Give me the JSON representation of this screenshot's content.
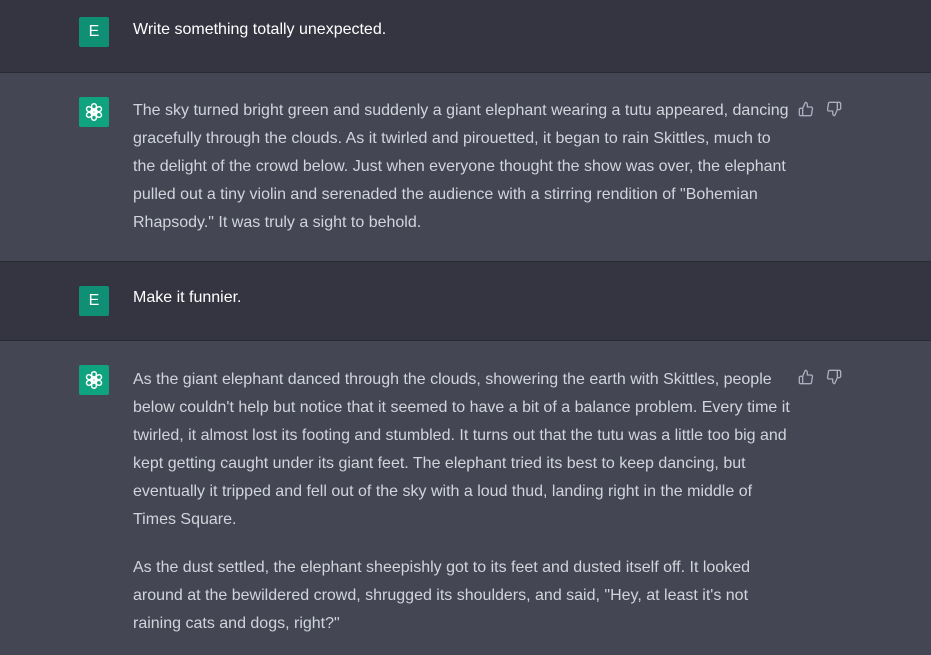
{
  "colors": {
    "user_bg": "#343541",
    "assistant_bg": "#444654",
    "user_avatar": "#0f8f74",
    "bot_avatar": "#10a37f",
    "assistant_text": "#d1d5db",
    "icon": "#acacbe"
  },
  "messages": [
    {
      "role": "user",
      "avatar_initial": "E",
      "text": "Write something totally unexpected."
    },
    {
      "role": "assistant",
      "avatar_icon": "openai-logo-icon",
      "paragraphs": [
        "The sky turned bright green and suddenly a giant elephant wearing a tutu appeared, dancing gracefully through the clouds. As it twirled and pirouetted, it began to rain Skittles, much to the delight of the crowd below. Just when everyone thought the show was over, the elephant pulled out a tiny violin and serenaded the audience with a stirring rendition of \"Bohemian Rhapsody.\" It was truly a sight to behold."
      ],
      "feedback_icons": [
        "thumbs-up-icon",
        "thumbs-down-icon"
      ]
    },
    {
      "role": "user",
      "avatar_initial": "E",
      "text": "Make it funnier."
    },
    {
      "role": "assistant",
      "avatar_icon": "openai-logo-icon",
      "paragraphs": [
        "As the giant elephant danced through the clouds, showering the earth with Skittles, people below couldn't help but notice that it seemed to have a bit of a balance problem. Every time it twirled, it almost lost its footing and stumbled. It turns out that the tutu was a little too big and kept getting caught under its giant feet. The elephant tried its best to keep dancing, but eventually it tripped and fell out of the sky with a loud thud, landing right in the middle of Times Square.",
        "As the dust settled, the elephant sheepishly got to its feet and dusted itself off. It looked around at the bewildered crowd, shrugged its shoulders, and said, \"Hey, at least it's not raining cats and dogs, right?\""
      ],
      "feedback_icons": [
        "thumbs-up-icon",
        "thumbs-down-icon"
      ]
    }
  ]
}
